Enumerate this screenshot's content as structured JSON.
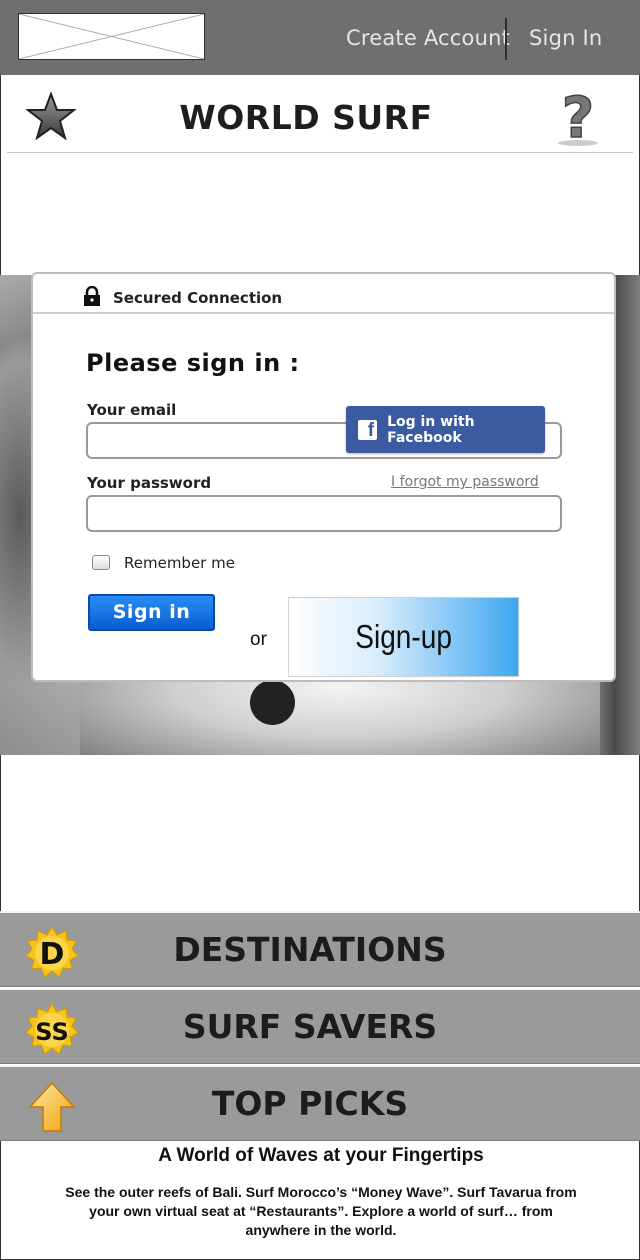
{
  "topbar": {
    "create_account": "Create Account",
    "sign_in": "Sign In"
  },
  "header": {
    "title": "WORLD SURF"
  },
  "login": {
    "secured": "Secured Connection",
    "heading": "Please sign in :",
    "email_label": "Your email",
    "email_value": "",
    "password_label": "Your password",
    "password_value": "",
    "facebook_button": "Log in with Facebook",
    "forgot_password": "I forgot my password",
    "remember_me": "Remember me",
    "sign_in_button": "Sign in",
    "or": "or",
    "signup_button": "Sign-up"
  },
  "menu": {
    "items": [
      {
        "label": "DESTINATIONS",
        "badge": "D"
      },
      {
        "label": "SURF SAVERS",
        "badge": "SS"
      },
      {
        "label": "TOP PICKS",
        "badge": "arrow-up"
      }
    ]
  },
  "footer": {
    "title": "A World of Waves at your Fingertips",
    "text": "See the outer reefs of Bali. Surf Morocco’s “Money Wave”. Surf Tavarua from your own virtual seat at “Restaurants”. Explore a world of surf… from anywhere in the world."
  },
  "colors": {
    "topbar": "#6f6f6f",
    "menu": "#9a9a9a",
    "facebook": "#3b5aa0",
    "sign_in_button": "#0a5fd0",
    "badge": "#f7c21a"
  },
  "icons": {
    "logo": "image-placeholder",
    "favorite": "star-icon",
    "help": "question-mark-icon",
    "secure": "lock-icon",
    "facebook": "facebook-icon"
  }
}
